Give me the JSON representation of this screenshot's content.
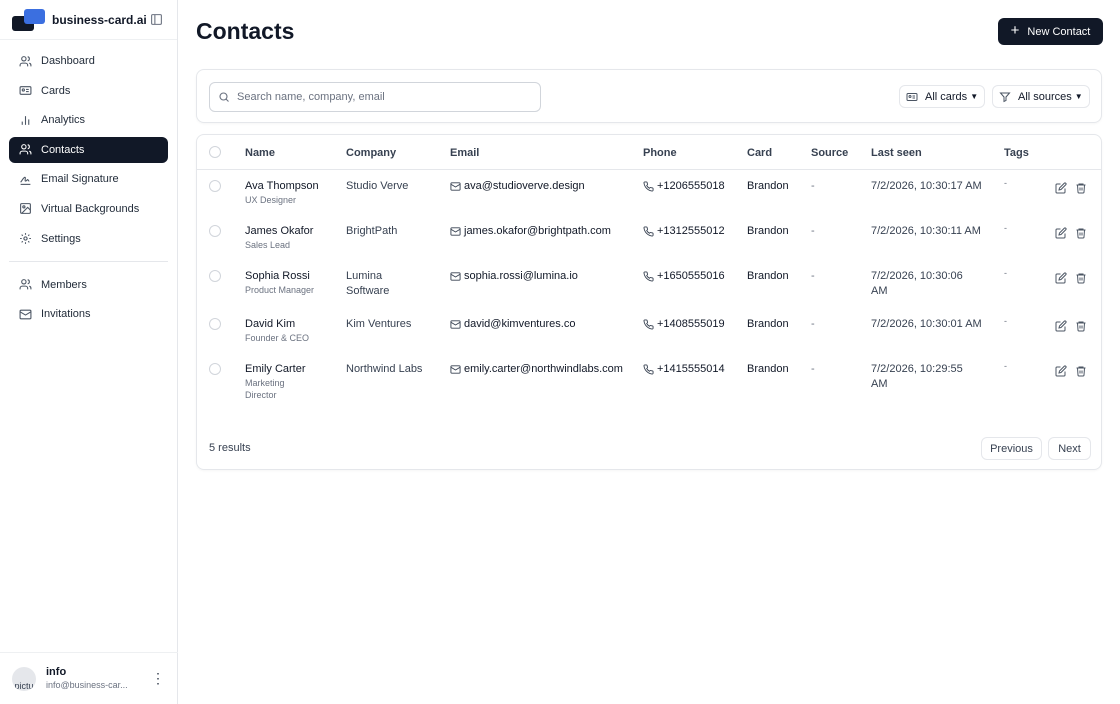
{
  "app": {
    "name": "business-card.ai"
  },
  "sidebar": {
    "items": [
      {
        "label": "Dashboard",
        "icon": "dashboard-icon"
      },
      {
        "label": "Cards",
        "icon": "card-icon"
      },
      {
        "label": "Analytics",
        "icon": "bar-chart-icon"
      },
      {
        "label": "Contacts",
        "icon": "users-icon",
        "active": true
      },
      {
        "label": "Email Signature",
        "icon": "signature-icon"
      },
      {
        "label": "Virtual Backgrounds",
        "icon": "image-icon"
      },
      {
        "label": "Settings",
        "icon": "gear-icon"
      }
    ],
    "secondary_items": [
      {
        "label": "Members",
        "icon": "members-icon"
      },
      {
        "label": "Invitations",
        "icon": "mail-icon"
      }
    ]
  },
  "user": {
    "name": "info",
    "email": "info@business-car...",
    "avatar_alt": "pictu"
  },
  "page": {
    "title": "Contacts",
    "new_button": "New Contact"
  },
  "filters": {
    "search_placeholder": "Search name, company, email",
    "cards_select": "All cards",
    "sources_select": "All sources"
  },
  "table": {
    "headers": {
      "name": "Name",
      "company": "Company",
      "email": "Email",
      "phone": "Phone",
      "card": "Card",
      "source": "Source",
      "last_seen": "Last seen",
      "tags": "Tags"
    },
    "rows": [
      {
        "name": "Ava Thompson",
        "title": "UX Designer",
        "company_l1": "Studio Verve",
        "company_l2": "",
        "email": "ava@studioverve.design",
        "phone": "+1206555018",
        "card": "Brandon",
        "source": "-",
        "last_seen_l1": "7/2/2026, 10:30:17 AM",
        "last_seen_l2": "",
        "tags": "-"
      },
      {
        "name": "James Okafor",
        "title": "Sales Lead",
        "company_l1": "BrightPath",
        "company_l2": "",
        "email": "james.okafor@brightpath.com",
        "phone": "+1312555012",
        "card": "Brandon",
        "source": "-",
        "last_seen_l1": "7/2/2026, 10:30:11 AM",
        "last_seen_l2": "",
        "tags": "-"
      },
      {
        "name": "Sophia Rossi",
        "title": "Product Manager",
        "company_l1": "Lumina",
        "company_l2": "Software",
        "email": "sophia.rossi@lumina.io",
        "phone": "+1650555016",
        "card": "Brandon",
        "source": "-",
        "last_seen_l1": "7/2/2026, 10:30:06",
        "last_seen_l2": "AM",
        "tags": "-"
      },
      {
        "name": "David Kim",
        "title": "Founder & CEO",
        "company_l1": "Kim Ventures",
        "company_l2": "",
        "email": "david@kimventures.co",
        "phone": "+1408555019",
        "card": "Brandon",
        "source": "-",
        "last_seen_l1": "7/2/2026, 10:30:01 AM",
        "last_seen_l2": "",
        "tags": "-"
      },
      {
        "name": "Emily Carter",
        "title": "Marketing Director",
        "company_l1": "Northwind Labs",
        "company_l2": "",
        "email": "emily.carter@northwindlabs.com",
        "phone": "+1415555014",
        "card": "Brandon",
        "source": "-",
        "last_seen_l1": "7/2/2026, 10:29:55",
        "last_seen_l2": "AM",
        "tags": "-"
      }
    ]
  },
  "pagination": {
    "results": "5 results",
    "previous": "Previous",
    "next": "Next"
  }
}
